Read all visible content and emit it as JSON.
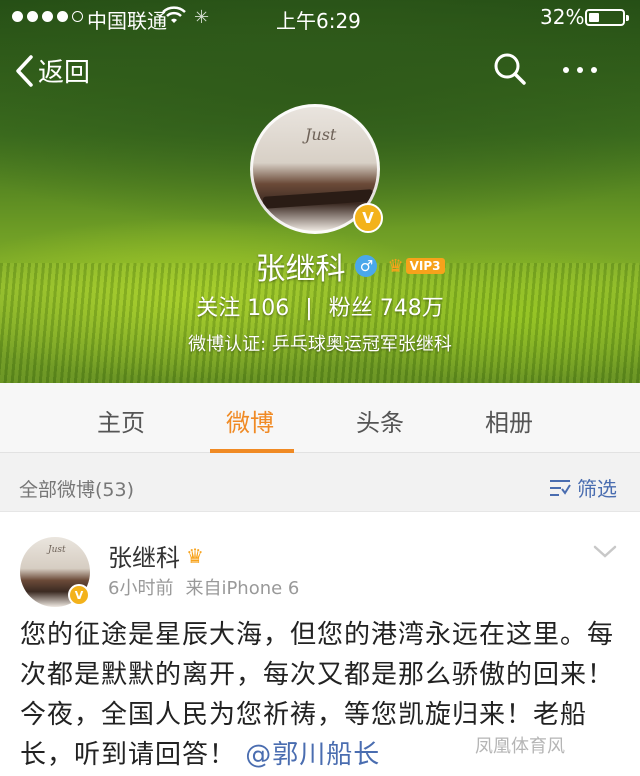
{
  "status_bar": {
    "carrier": "中国联通",
    "time": "上午6:29",
    "battery": "32%"
  },
  "nav": {
    "back_label": "返回"
  },
  "profile": {
    "avatar_script": "Just",
    "name": "张继科",
    "gender_symbol": "♂",
    "vip_label": "VIP3",
    "follow_label": "关注",
    "follow_count": "106",
    "fans_label": "粉丝",
    "fans_count": "748万",
    "verification": "微博认证: 乒乓球奥运冠军张继科"
  },
  "tabs": [
    {
      "label": "主页",
      "active": false
    },
    {
      "label": "微博",
      "active": true
    },
    {
      "label": "头条",
      "active": false
    },
    {
      "label": "相册",
      "active": false
    }
  ],
  "filter": {
    "count_label": "全部微博(53)",
    "button_label": "筛选"
  },
  "post": {
    "avatar_script": "Just",
    "author": "张继科",
    "time": "6小时前",
    "source": "来自iPhone 6",
    "text": "您的征途是星辰大海，但您的港湾永远在这里。每次都是默默的离开，每次又都是那么骄傲的回来！今夜，全国人民为您祈祷，等您凯旋归来！老船长，听到请回答！",
    "mention": "@郭川船长",
    "watermark": "凤凰体育风"
  },
  "colors": {
    "accent": "#f08a24",
    "link": "#4a6db0",
    "verified": "#f3b21b"
  }
}
